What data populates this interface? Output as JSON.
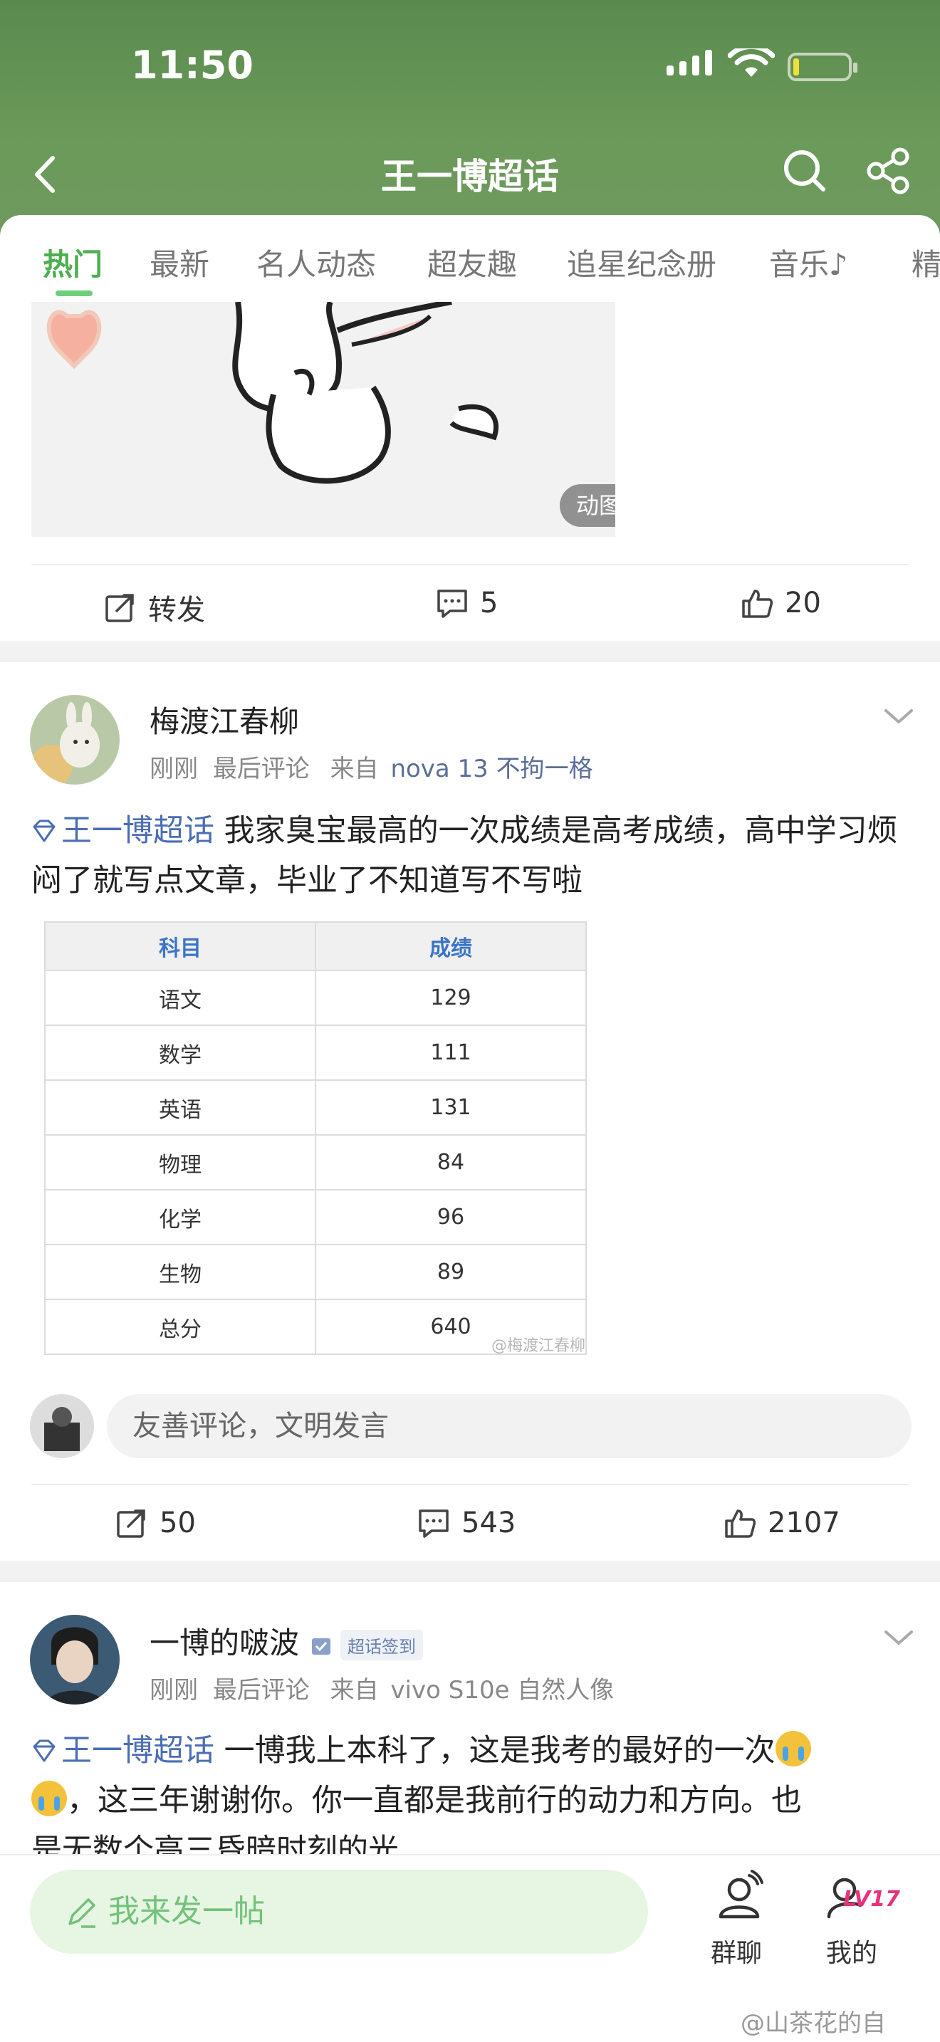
{
  "status": {
    "time": "11:50"
  },
  "nav": {
    "title": "王一博超话"
  },
  "tabs": [
    {
      "label": "热门"
    },
    {
      "label": "最新"
    },
    {
      "label": "名人动态"
    },
    {
      "label": "超友趣"
    },
    {
      "label": "追星纪念册"
    },
    {
      "label": "音乐♪"
    },
    {
      "label": "精"
    }
  ],
  "post0": {
    "gif_badge": "动图",
    "actions": {
      "repost": "转发",
      "comments": "5",
      "likes": "20"
    }
  },
  "post1": {
    "username": "梅渡江春柳",
    "time": "刚刚",
    "last_comment": "最后评论",
    "from": "来自",
    "device": "nova 13 不拘一格",
    "topic": "王一博超话",
    "text": " 我家臭宝最高的一次成绩是高考成绩，高中学习烦闷了就写点文章，毕业了不知道写不写啦",
    "table": {
      "headers": [
        "科目",
        "成绩"
      ],
      "rows": [
        [
          "语文",
          "129"
        ],
        [
          "数学",
          "111"
        ],
        [
          "英语",
          "131"
        ],
        [
          "物理",
          "84"
        ],
        [
          "化学",
          "96"
        ],
        [
          "生物",
          "89"
        ],
        [
          "总分",
          "640"
        ]
      ],
      "watermark": "@梅渡江春柳"
    },
    "comment_placeholder": "友善评论，文明发言",
    "actions": {
      "reposts": "50",
      "comments": "543",
      "likes": "2107"
    }
  },
  "post2": {
    "username": "一博的啵波",
    "badge": "超话签到",
    "time": "刚刚",
    "last_comment": "最后评论",
    "from": "来自",
    "device": "vivo S10e 自然人像",
    "topic": "王一博超话",
    "text_a": " 一博我上本科了，这是我考的最好的一次",
    "text_b": "，这三年谢谢你。你一直都是我前行的动力和方向。也",
    "text_c": "是无数个高三昏暗时刻的光"
  },
  "bottom": {
    "post_button": "我来发一帖",
    "group_chat": "群聊",
    "mine": "我的",
    "level": "LV17"
  },
  "footer_watermark": "@山茶花的自"
}
